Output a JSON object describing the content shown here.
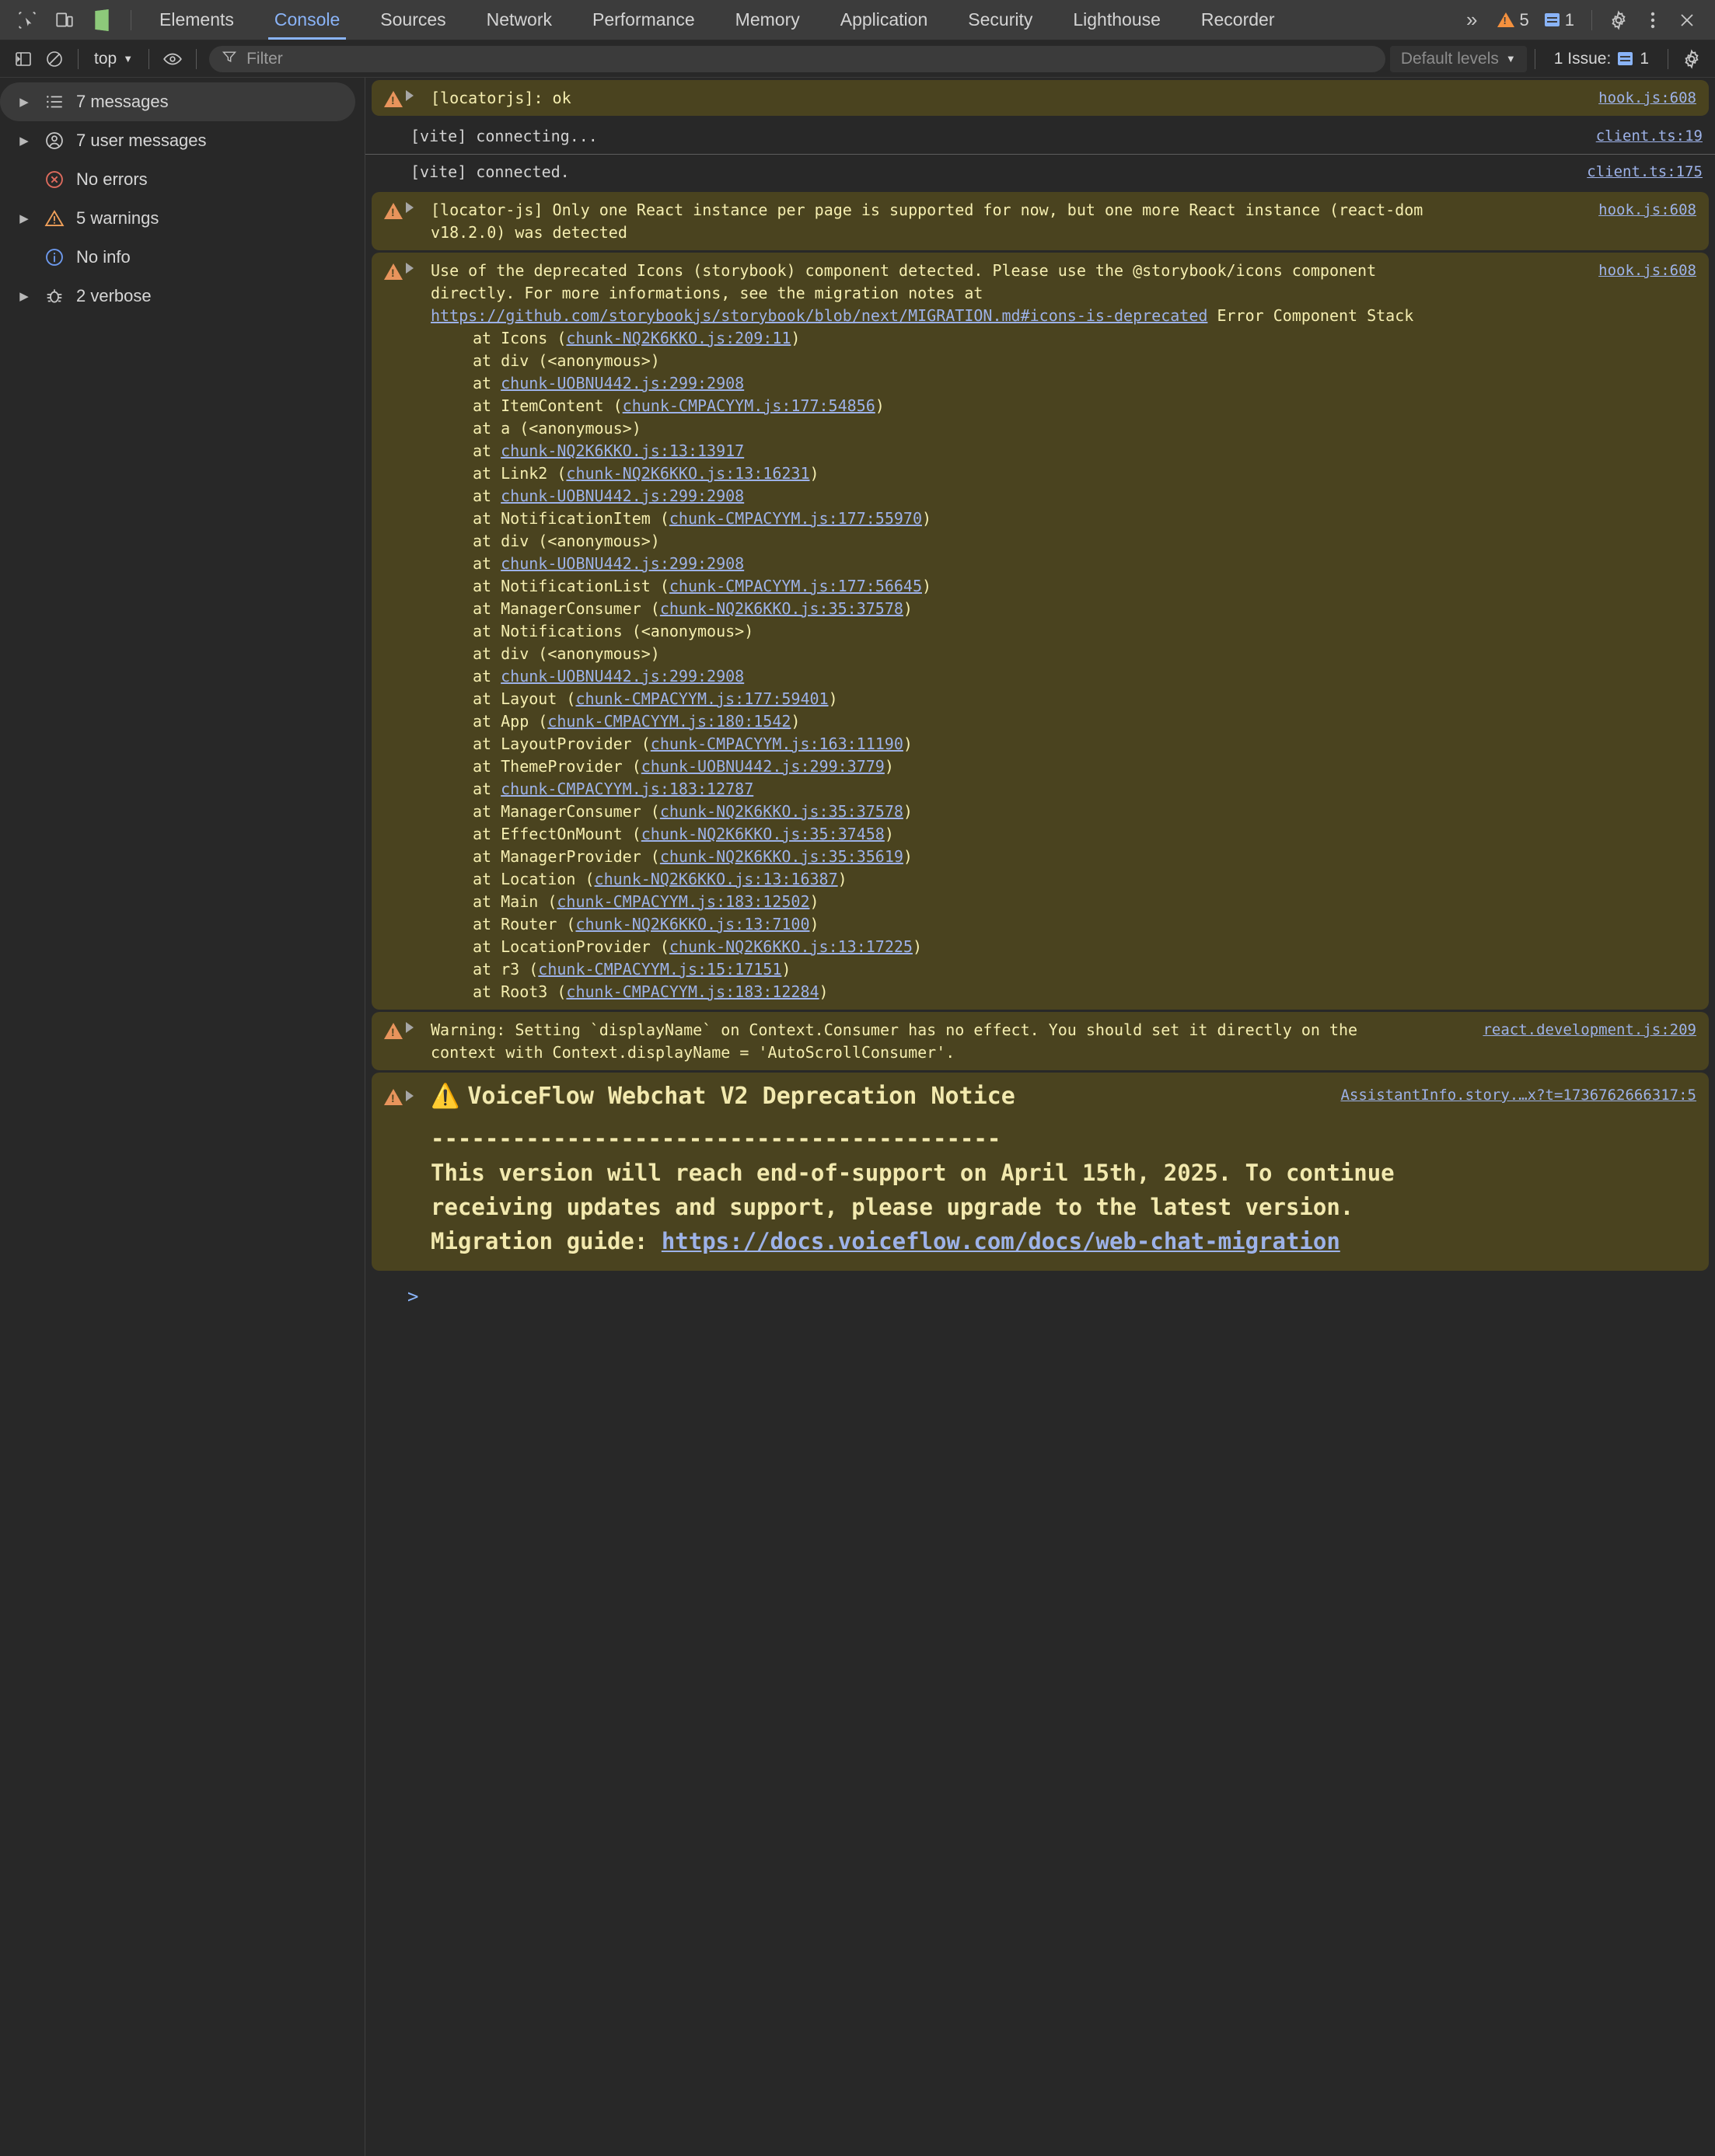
{
  "header": {
    "left_icons": [
      "inspect-element-icon",
      "device-toolbar-icon",
      "storybook-logo-icon"
    ],
    "tabs": [
      {
        "label": "Elements",
        "active": false
      },
      {
        "label": "Console",
        "active": true
      },
      {
        "label": "Sources",
        "active": false
      },
      {
        "label": "Network",
        "active": false
      },
      {
        "label": "Performance",
        "active": false
      },
      {
        "label": "Memory",
        "active": false
      },
      {
        "label": "Application",
        "active": false
      },
      {
        "label": "Security",
        "active": false
      },
      {
        "label": "Lighthouse",
        "active": false
      },
      {
        "label": "Recorder",
        "active": false
      }
    ],
    "overflow_label": "»",
    "warning_count": "5",
    "message_count": "1",
    "accent_color": "#8ab4f8",
    "warning_color": "#f5913e"
  },
  "toolbar": {
    "sidebar_toggle_icon": "sidebar-panel-icon",
    "clear_console_icon": "clear-console-icon",
    "context_label": "top",
    "eye_icon": "live-expression-icon",
    "filter_placeholder": "Filter",
    "filter_value": "",
    "levels_label": "Default levels",
    "issues_label": "1 Issue:",
    "issues_count": "1",
    "settings_icon": "gear-icon"
  },
  "sidebar": {
    "items": [
      {
        "label": "7 messages",
        "icon": "list-icon",
        "has_disclosure": true,
        "selected": true
      },
      {
        "label": "7 user messages",
        "icon": "user-icon",
        "has_disclosure": true,
        "selected": false
      },
      {
        "label": "No errors",
        "icon": "error-icon",
        "has_disclosure": false,
        "selected": false
      },
      {
        "label": "5 warnings",
        "icon": "warning-icon",
        "has_disclosure": true,
        "selected": false
      },
      {
        "label": "No info",
        "icon": "info-icon",
        "has_disclosure": false,
        "selected": false
      },
      {
        "label": "2 verbose",
        "icon": "bug-icon",
        "has_disclosure": true,
        "selected": false
      }
    ]
  },
  "console": {
    "prompt_symbol": ">",
    "messages": [
      {
        "kind": "warning",
        "text": "[locatorjs]: ok",
        "source": "hook.js:608"
      },
      {
        "kind": "log",
        "text": "[vite] connecting...",
        "source": "client.ts:19"
      },
      {
        "kind": "log",
        "text": "[vite] connected.",
        "source": "client.ts:175"
      },
      {
        "kind": "warning",
        "text": "[locator-js] Only one React instance per page is supported for now, but one more React instance (react-dom v18.2.0) was detected",
        "source": "hook.js:608"
      },
      {
        "kind": "warning-stack",
        "text_line1": "Use of the deprecated Icons (storybook) component detected. Please use the @storybook/icons component",
        "text_line2": "directly. For more informations, see the migration notes at",
        "link": "https://github.com/storybookjs/storybook/blob/next/MIGRATION.md#icons-is-deprecated",
        "link_suffix": " Error Component Stack",
        "source": "hook.js:608",
        "stack": [
          {
            "prefix": "at Icons (",
            "link": "chunk-NQ2K6KKO.js:209:11",
            "suffix": ")"
          },
          {
            "prefix": "at div (<anonymous>)",
            "link": "",
            "suffix": ""
          },
          {
            "prefix": "at ",
            "link": "chunk-UOBNU442.js:299:2908",
            "suffix": ""
          },
          {
            "prefix": "at ItemContent (",
            "link": "chunk-CMPACYYM.js:177:54856",
            "suffix": ")"
          },
          {
            "prefix": "at a (<anonymous>)",
            "link": "",
            "suffix": ""
          },
          {
            "prefix": "at ",
            "link": "chunk-NQ2K6KKO.js:13:13917",
            "suffix": ""
          },
          {
            "prefix": "at Link2 (",
            "link": "chunk-NQ2K6KKO.js:13:16231",
            "suffix": ")"
          },
          {
            "prefix": "at ",
            "link": "chunk-UOBNU442.js:299:2908",
            "suffix": ""
          },
          {
            "prefix": "at NotificationItem (",
            "link": "chunk-CMPACYYM.js:177:55970",
            "suffix": ")"
          },
          {
            "prefix": "at div (<anonymous>)",
            "link": "",
            "suffix": ""
          },
          {
            "prefix": "at ",
            "link": "chunk-UOBNU442.js:299:2908",
            "suffix": ""
          },
          {
            "prefix": "at NotificationList (",
            "link": "chunk-CMPACYYM.js:177:56645",
            "suffix": ")"
          },
          {
            "prefix": "at ManagerConsumer (",
            "link": "chunk-NQ2K6KKO.js:35:37578",
            "suffix": ")"
          },
          {
            "prefix": "at Notifications (<anonymous>)",
            "link": "",
            "suffix": ""
          },
          {
            "prefix": "at div (<anonymous>)",
            "link": "",
            "suffix": ""
          },
          {
            "prefix": "at ",
            "link": "chunk-UOBNU442.js:299:2908",
            "suffix": ""
          },
          {
            "prefix": "at Layout (",
            "link": "chunk-CMPACYYM.js:177:59401",
            "suffix": ")"
          },
          {
            "prefix": "at App (",
            "link": "chunk-CMPACYYM.js:180:1542",
            "suffix": ")"
          },
          {
            "prefix": "at LayoutProvider (",
            "link": "chunk-CMPACYYM.js:163:11190",
            "suffix": ")"
          },
          {
            "prefix": "at ThemeProvider (",
            "link": "chunk-UOBNU442.js:299:3779",
            "suffix": ")"
          },
          {
            "prefix": "at ",
            "link": "chunk-CMPACYYM.js:183:12787",
            "suffix": ""
          },
          {
            "prefix": "at ManagerConsumer (",
            "link": "chunk-NQ2K6KKO.js:35:37578",
            "suffix": ")"
          },
          {
            "prefix": "at EffectOnMount (",
            "link": "chunk-NQ2K6KKO.js:35:37458",
            "suffix": ")"
          },
          {
            "prefix": "at ManagerProvider (",
            "link": "chunk-NQ2K6KKO.js:35:35619",
            "suffix": ")"
          },
          {
            "prefix": "at Location (",
            "link": "chunk-NQ2K6KKO.js:13:16387",
            "suffix": ")"
          },
          {
            "prefix": "at Main (",
            "link": "chunk-CMPACYYM.js:183:12502",
            "suffix": ")"
          },
          {
            "prefix": "at Router (",
            "link": "chunk-NQ2K6KKO.js:13:7100",
            "suffix": ")"
          },
          {
            "prefix": "at LocationProvider (",
            "link": "chunk-NQ2K6KKO.js:13:17225",
            "suffix": ")"
          },
          {
            "prefix": "at r3 (",
            "link": "chunk-CMPACYYM.js:15:17151",
            "suffix": ")"
          },
          {
            "prefix": "at Root3 (",
            "link": "chunk-CMPACYYM.js:183:12284",
            "suffix": ")"
          }
        ]
      },
      {
        "kind": "warning",
        "text": "Warning: Setting `displayName` on Context.Consumer has no effect. You should set it directly on the context with Context.displayName = 'AutoScrollConsumer'.",
        "source": "react.development.js:209"
      },
      {
        "kind": "voiceflow",
        "warn_glyph": "⚠️",
        "title": "VoiceFlow Webchat V2 Deprecation Notice",
        "rule": "------------------------------------------",
        "body_line1": "This version will reach end-of-support on April 15th, 2025. To continue",
        "body_line2": "receiving updates and support, please upgrade to the latest version.",
        "body_line3_prefix": "Migration guide: ",
        "body_link": "https://docs.voiceflow.com/docs/web-chat-migration",
        "source": "AssistantInfo.story.…x?t=1736762666317:5"
      }
    ]
  },
  "colors": {
    "warning_bg": "#4a431f",
    "warning_text": "#f5eeb0",
    "link": "#9db2e8",
    "panel_bg": "#282828",
    "toolbar_bg": "#3c3c3c"
  }
}
